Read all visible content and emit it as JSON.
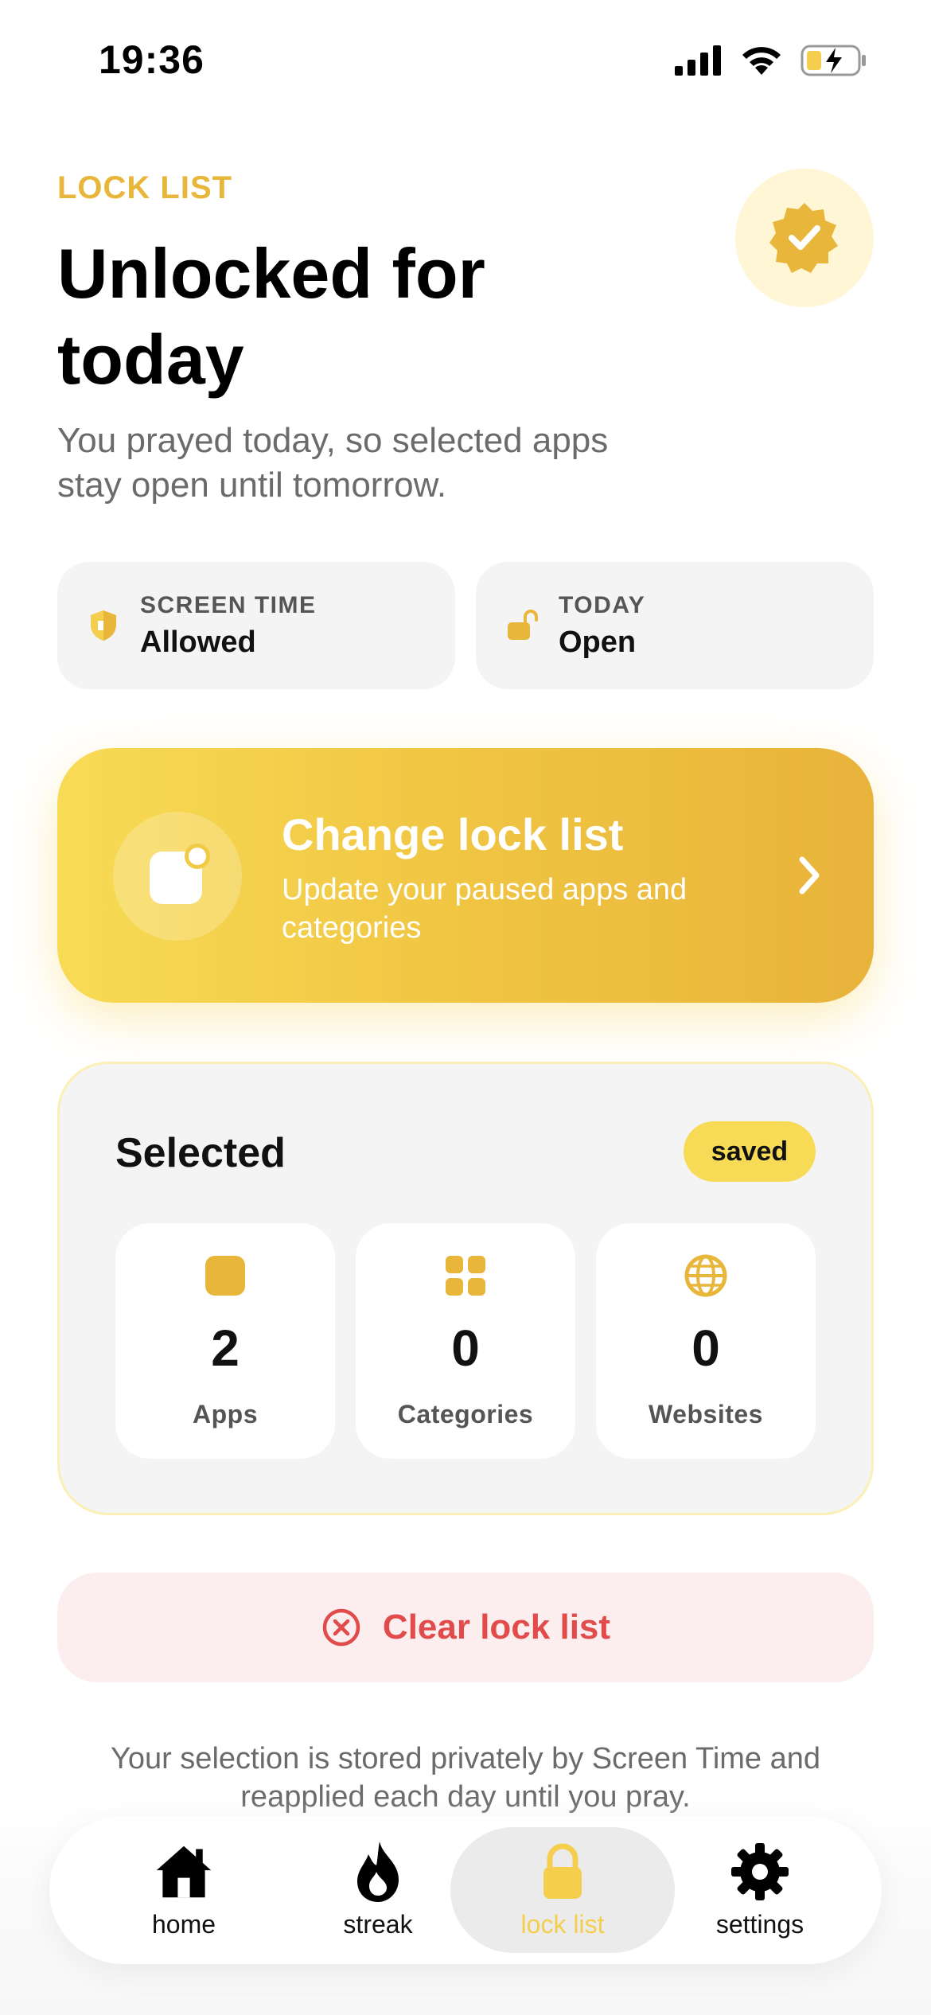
{
  "status_bar": {
    "time": "19:36"
  },
  "header": {
    "eyebrow": "LOCK LIST",
    "title": "Unlocked for today",
    "subtitle": "You prayed today, so selected apps stay open until tomorrow."
  },
  "pills": [
    {
      "label": "SCREEN TIME",
      "value": "Allowed",
      "icon": "shield-icon"
    },
    {
      "label": "TODAY",
      "value": "Open",
      "icon": "unlocked-padlock-icon"
    }
  ],
  "cta": {
    "title": "Change lock list",
    "subtitle": "Update your paused apps and categories"
  },
  "selected": {
    "title": "Selected",
    "badge": "saved",
    "tiles": [
      {
        "count": "2",
        "label": "Apps",
        "icon": "app-square-icon"
      },
      {
        "count": "0",
        "label": "Categories",
        "icon": "grid-icon"
      },
      {
        "count": "0",
        "label": "Websites",
        "icon": "globe-icon"
      }
    ]
  },
  "clear_button": {
    "label": "Clear lock list"
  },
  "footer_note": "Your selection is stored privately by Screen Time and reapplied each day until you pray.",
  "tabbar": {
    "items": [
      {
        "label": "home",
        "icon": "house-icon"
      },
      {
        "label": "streak",
        "icon": "flame-icon"
      },
      {
        "label": "lock list",
        "icon": "padlock-icon",
        "active": true
      },
      {
        "label": "settings",
        "icon": "gear-icon"
      }
    ]
  },
  "colors": {
    "accent": "#E8B63A",
    "accent_light": "#F7DA55",
    "danger": "#E14B4B",
    "danger_bg": "#FCEEEE",
    "card_bg": "#F4F4F4"
  }
}
